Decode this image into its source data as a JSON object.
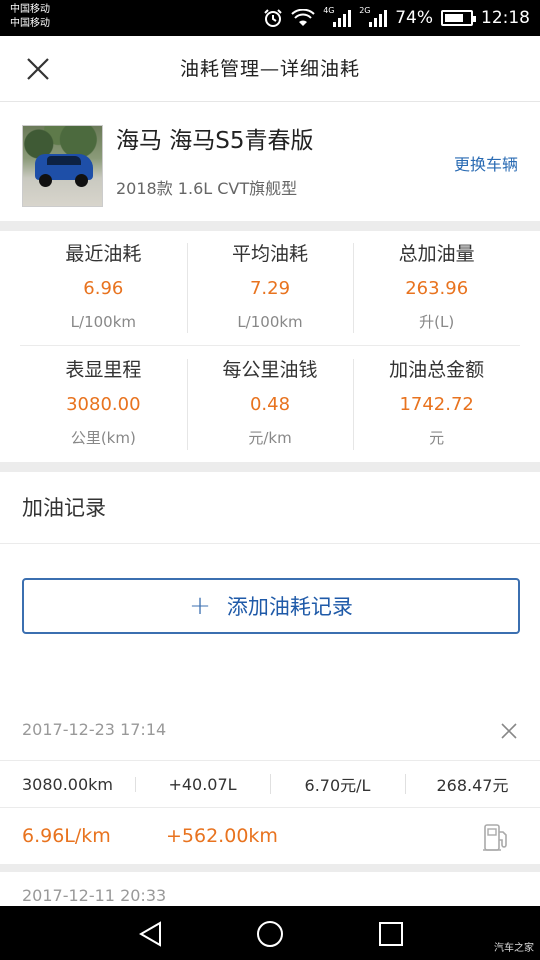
{
  "status_bar": {
    "carrier1": "中国移动",
    "carrier2": "中国移动",
    "sig1_tag": "4G",
    "sig2_tag": "2G",
    "battery": "74%",
    "battery_level": 0.74,
    "time": "12:18"
  },
  "header": {
    "title": "油耗管理—详细油耗"
  },
  "car": {
    "name": "海马 海马S5青春版",
    "model": "2018款 1.6L CVT旗舰型",
    "change_label": "更换车辆"
  },
  "stats": [
    {
      "label": "最近油耗",
      "value": "6.96",
      "unit": "L/100km"
    },
    {
      "label": "平均油耗",
      "value": "7.29",
      "unit": "L/100km"
    },
    {
      "label": "总加油量",
      "value": "263.96",
      "unit": "升(L)"
    },
    {
      "label": "表显里程",
      "value": "3080.00",
      "unit": "公里(km)"
    },
    {
      "label": "每公里油钱",
      "value": "0.48",
      "unit": "元/km"
    },
    {
      "label": "加油总金额",
      "value": "1742.72",
      "unit": "元"
    }
  ],
  "records": {
    "title": "加油记录",
    "add_label": "添加油耗记录",
    "items": [
      {
        "date": "2017-12-23 17:14",
        "mileage": "3080.00km",
        "fuel": "+40.07L",
        "price": "6.70元/L",
        "amount": "268.47元",
        "consumption": "6.96L/km",
        "distance": "+562.00km"
      },
      {
        "date": "2017-12-11 20:33"
      }
    ]
  },
  "watermark": "汽车之家",
  "colors": {
    "accent_orange": "#e8731f",
    "link_blue": "#2a6bb3",
    "button_blue": "#3b6fb0"
  }
}
